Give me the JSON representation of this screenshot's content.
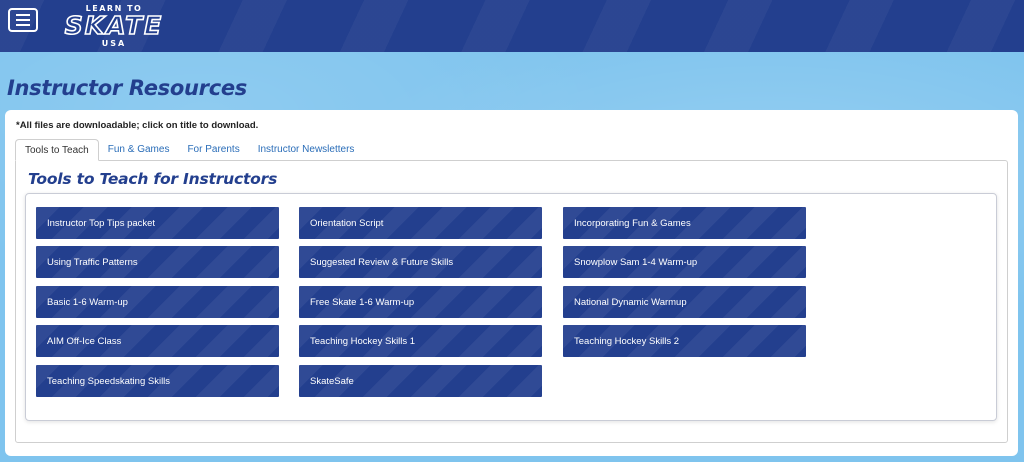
{
  "header": {
    "menu_icon": "hamburger-menu-icon",
    "logo": {
      "top": "LEARN TO",
      "main": "SKATE",
      "bottom": "USA"
    }
  },
  "page": {
    "title": "Instructor Resources",
    "note": "*All files are downloadable; click on title to download."
  },
  "tabs": [
    {
      "label": "Tools to Teach",
      "active": true
    },
    {
      "label": "Fun & Games",
      "active": false
    },
    {
      "label": "For Parents",
      "active": false
    },
    {
      "label": "Instructor Newsletters",
      "active": false
    }
  ],
  "panel": {
    "title": "Tools to Teach for Instructors",
    "columns": [
      [
        "Instructor Top Tips packet",
        "Using Traffic Patterns",
        "Basic 1-6 Warm-up",
        "AIM Off-Ice Class",
        "Teaching Speedskating Skills"
      ],
      [
        "Orientation Script",
        "Suggested Review & Future Skills",
        "Free Skate 1-6 Warm-up",
        "Teaching Hockey Skills 1",
        "SkateSafe"
      ],
      [
        "Incorporating Fun & Games",
        "Snowplow Sam 1-4 Warm-up",
        "National Dynamic Warmup",
        "Teaching Hockey Skills 2"
      ]
    ]
  },
  "colors": {
    "brand_navy": "#233f8e",
    "background_sky": "#7fc4ee",
    "tab_link": "#2a6db8"
  }
}
